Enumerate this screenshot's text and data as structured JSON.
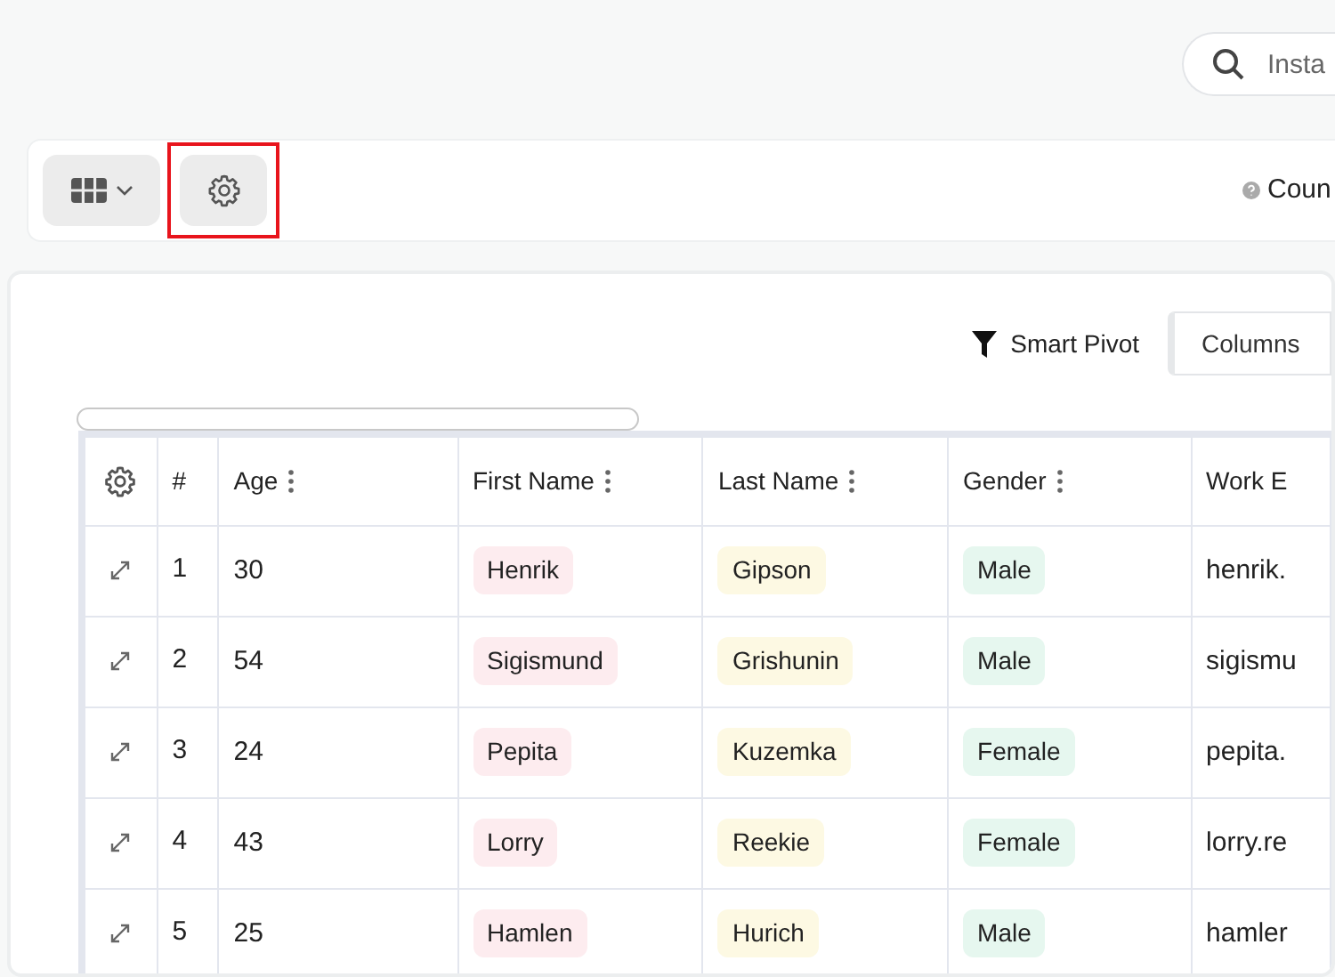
{
  "search": {
    "placeholder": "Insta"
  },
  "toolbar": {
    "view_button": {
      "expanded": false
    },
    "settings_button": {
      "highlighted": true
    },
    "count_label": "Coun"
  },
  "panel": {
    "smart_pivot": "Smart Pivot",
    "columns_button": "Columns"
  },
  "table": {
    "columns": [
      {
        "label": "#",
        "kind": "index",
        "menu": false
      },
      {
        "label": "Age",
        "kind": "text",
        "menu": true
      },
      {
        "label": "First Name",
        "kind": "tag-pink",
        "menu": true
      },
      {
        "label": "Last Name",
        "kind": "tag-yellow",
        "menu": true
      },
      {
        "label": "Gender",
        "kind": "tag-green",
        "menu": true
      },
      {
        "label": "Work E",
        "kind": "text",
        "menu": false
      }
    ],
    "rows": [
      [
        "1",
        "30",
        "Henrik",
        "Gipson",
        "Male",
        "henrik."
      ],
      [
        "2",
        "54",
        "Sigismund",
        "Grishunin",
        "Male",
        "sigismu"
      ],
      [
        "3",
        "24",
        "Pepita",
        "Kuzemka",
        "Female",
        "pepita."
      ],
      [
        "4",
        "43",
        "Lorry",
        "Reekie",
        "Female",
        "lorry.re"
      ],
      [
        "5",
        "25",
        "Hamlen",
        "Hurich",
        "Male",
        "hamler"
      ]
    ]
  }
}
